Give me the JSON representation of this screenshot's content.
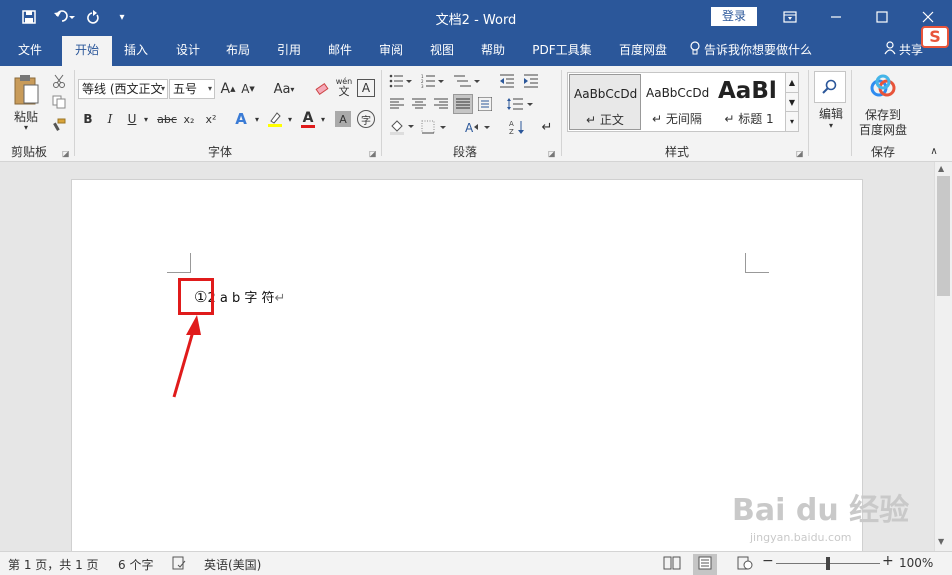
{
  "titlebar": {
    "title": "文档2  -  Word",
    "login_label": "登录",
    "quick_access": {
      "save_icon": "save-icon",
      "undo_icon": "undo-icon",
      "redo_icon": "redo-icon",
      "customize_icon": "customize-icon"
    }
  },
  "tabs": [
    {
      "label": "文件"
    },
    {
      "label": "开始"
    },
    {
      "label": "插入"
    },
    {
      "label": "设计"
    },
    {
      "label": "布局"
    },
    {
      "label": "引用"
    },
    {
      "label": "邮件"
    },
    {
      "label": "审阅"
    },
    {
      "label": "视图"
    },
    {
      "label": "帮助"
    },
    {
      "label": "PDF工具集"
    },
    {
      "label": "百度网盘"
    }
  ],
  "active_tab": "开始",
  "tell_me": "告诉我你想要做什么",
  "share_label": "共享",
  "ribbon": {
    "clipboard": {
      "paste_label": "粘贴",
      "group_label": "剪贴板"
    },
    "font": {
      "font_name": "等线 (西文正文",
      "font_size": "五号",
      "bold": "B",
      "italic": "I",
      "underline": "U",
      "strike": "abc",
      "subscript": "x₂",
      "superscript": "x²",
      "grow": "A",
      "shrink": "A",
      "case": "Aa",
      "phonetic_top": "wén",
      "phonetic_bottom": "文",
      "border_char": "A",
      "effects": "A",
      "font_color": "A",
      "shade": "A",
      "circle_char": "字",
      "group_label": "字体"
    },
    "paragraph": {
      "group_label": "段落"
    },
    "styles": {
      "items": [
        {
          "preview": "AaBbCcDd",
          "name": "正文"
        },
        {
          "preview": "AaBbCcDd",
          "name": "无间隔"
        },
        {
          "preview": "AaBl",
          "name": "标题 1"
        }
      ],
      "group_label": "样式"
    },
    "editing": {
      "label": "编辑"
    },
    "save": {
      "label_line1": "保存到",
      "label_line2": "百度网盘",
      "group_label": "保存"
    }
  },
  "document": {
    "circled": "①",
    "rest": "2 a b  字  符",
    "para_mark": "↵"
  },
  "status": {
    "page": "第 1 页，共 1 页",
    "words": "6 个字",
    "language": "英语(美国)",
    "zoom": "100%",
    "zoom_minus": "−",
    "zoom_plus": "+"
  },
  "watermark": {
    "text": "Bai du 经验",
    "url": "jingyan.baidu.com"
  },
  "colors": {
    "brand": "#2b579a",
    "highlight_box": "#e01b1b",
    "arrow": "#e01b1b",
    "font_color_bar": "#e01b1b",
    "highlight_bar": "#ffff00"
  }
}
